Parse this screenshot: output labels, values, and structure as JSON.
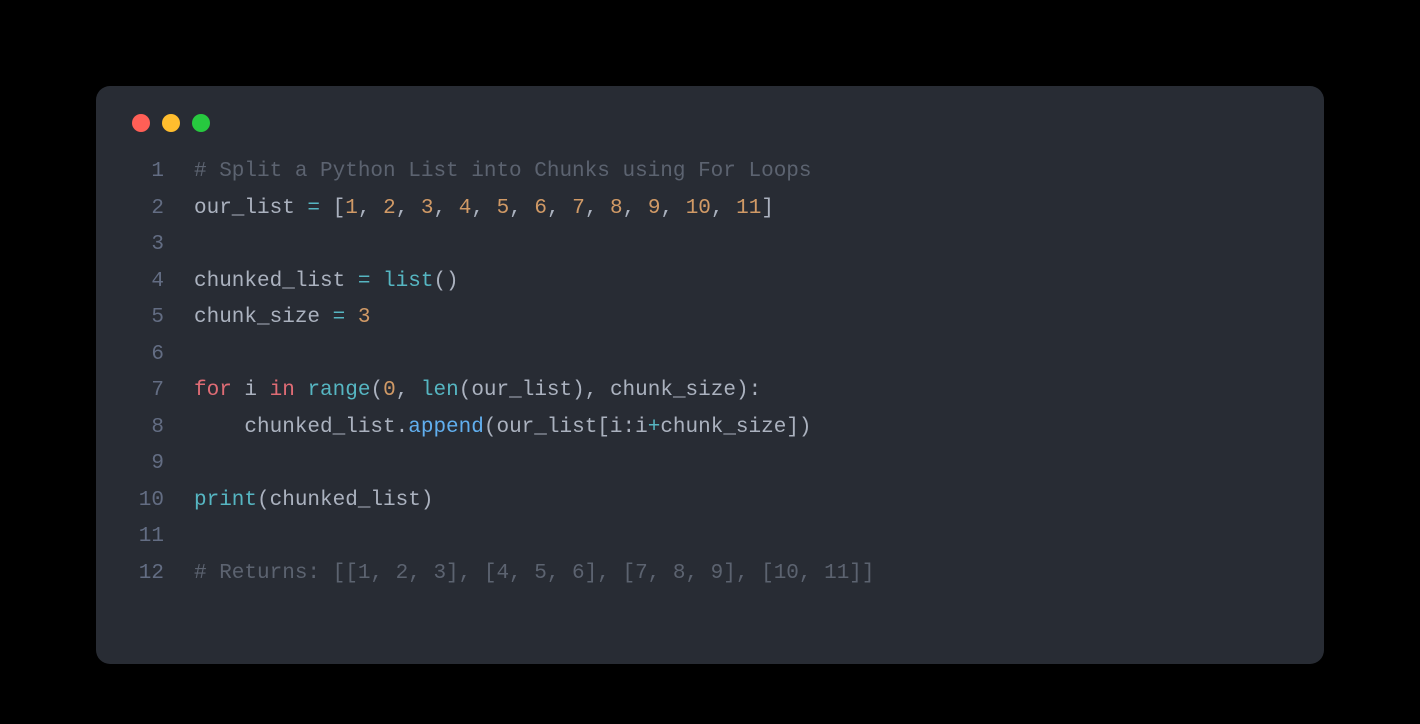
{
  "window": {
    "traffic_colors": [
      "#ff5f56",
      "#ffbd2e",
      "#27c93f"
    ]
  },
  "code": {
    "lines": [
      [
        {
          "cls": "tok-comment",
          "text": "# Split a Python List into Chunks using For Loops"
        }
      ],
      [
        {
          "cls": "tok-ident",
          "text": "our_list "
        },
        {
          "cls": "tok-operator",
          "text": "="
        },
        {
          "cls": "tok-paren",
          "text": " ["
        },
        {
          "cls": "tok-number",
          "text": "1"
        },
        {
          "cls": "tok-paren",
          "text": ", "
        },
        {
          "cls": "tok-number",
          "text": "2"
        },
        {
          "cls": "tok-paren",
          "text": ", "
        },
        {
          "cls": "tok-number",
          "text": "3"
        },
        {
          "cls": "tok-paren",
          "text": ", "
        },
        {
          "cls": "tok-number",
          "text": "4"
        },
        {
          "cls": "tok-paren",
          "text": ", "
        },
        {
          "cls": "tok-number",
          "text": "5"
        },
        {
          "cls": "tok-paren",
          "text": ", "
        },
        {
          "cls": "tok-number",
          "text": "6"
        },
        {
          "cls": "tok-paren",
          "text": ", "
        },
        {
          "cls": "tok-number",
          "text": "7"
        },
        {
          "cls": "tok-paren",
          "text": ", "
        },
        {
          "cls": "tok-number",
          "text": "8"
        },
        {
          "cls": "tok-paren",
          "text": ", "
        },
        {
          "cls": "tok-number",
          "text": "9"
        },
        {
          "cls": "tok-paren",
          "text": ", "
        },
        {
          "cls": "tok-number",
          "text": "10"
        },
        {
          "cls": "tok-paren",
          "text": ", "
        },
        {
          "cls": "tok-number",
          "text": "11"
        },
        {
          "cls": "tok-paren",
          "text": "]"
        }
      ],
      [],
      [
        {
          "cls": "tok-ident",
          "text": "chunked_list "
        },
        {
          "cls": "tok-operator",
          "text": "="
        },
        {
          "cls": "tok-builtin2",
          "text": " list"
        },
        {
          "cls": "tok-paren",
          "text": "()"
        }
      ],
      [
        {
          "cls": "tok-ident",
          "text": "chunk_size "
        },
        {
          "cls": "tok-operator",
          "text": "="
        },
        {
          "cls": "tok-ident",
          "text": " "
        },
        {
          "cls": "tok-number",
          "text": "3"
        }
      ],
      [],
      [
        {
          "cls": "tok-keyword2",
          "text": "for"
        },
        {
          "cls": "tok-ident",
          "text": " i "
        },
        {
          "cls": "tok-keyword2",
          "text": "in"
        },
        {
          "cls": "tok-ident",
          "text": " "
        },
        {
          "cls": "tok-builtin2",
          "text": "range"
        },
        {
          "cls": "tok-paren",
          "text": "("
        },
        {
          "cls": "tok-number",
          "text": "0"
        },
        {
          "cls": "tok-paren",
          "text": ", "
        },
        {
          "cls": "tok-builtin2",
          "text": "len"
        },
        {
          "cls": "tok-paren",
          "text": "(our_list), chunk_size):"
        }
      ],
      [
        {
          "cls": "tok-ident",
          "text": "    chunked_list."
        },
        {
          "cls": "tok-builtin",
          "text": "append"
        },
        {
          "cls": "tok-paren",
          "text": "(our_list[i:i"
        },
        {
          "cls": "tok-operator",
          "text": "+"
        },
        {
          "cls": "tok-paren",
          "text": "chunk_size])"
        }
      ],
      [],
      [
        {
          "cls": "tok-builtin2",
          "text": "print"
        },
        {
          "cls": "tok-paren",
          "text": "(chunked_list)"
        }
      ],
      [],
      [
        {
          "cls": "tok-comment",
          "text": "# Returns: [[1, 2, 3], [4, 5, 6], [7, 8, 9], [10, 11]]"
        }
      ]
    ]
  }
}
